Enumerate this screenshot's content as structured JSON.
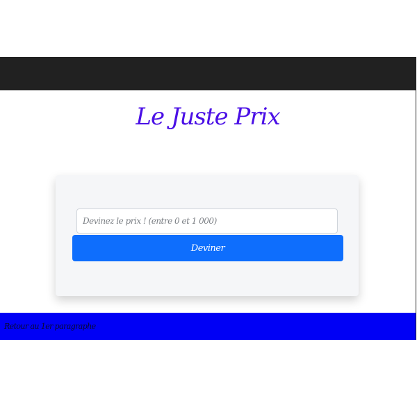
{
  "header": {
    "title": "Le Juste Prix"
  },
  "form": {
    "input_value": "",
    "input_placeholder": "Devinez le prix ! (entre 0 et 1 000)",
    "submit_label": "Deviner"
  },
  "footer": {
    "text": "Retour au 1er paragraphe"
  },
  "colors": {
    "topbar": "#212121",
    "title": "#4b10e6",
    "button": "#0e6efd",
    "footer": "#0000f5",
    "card": "#f5f6f8"
  }
}
